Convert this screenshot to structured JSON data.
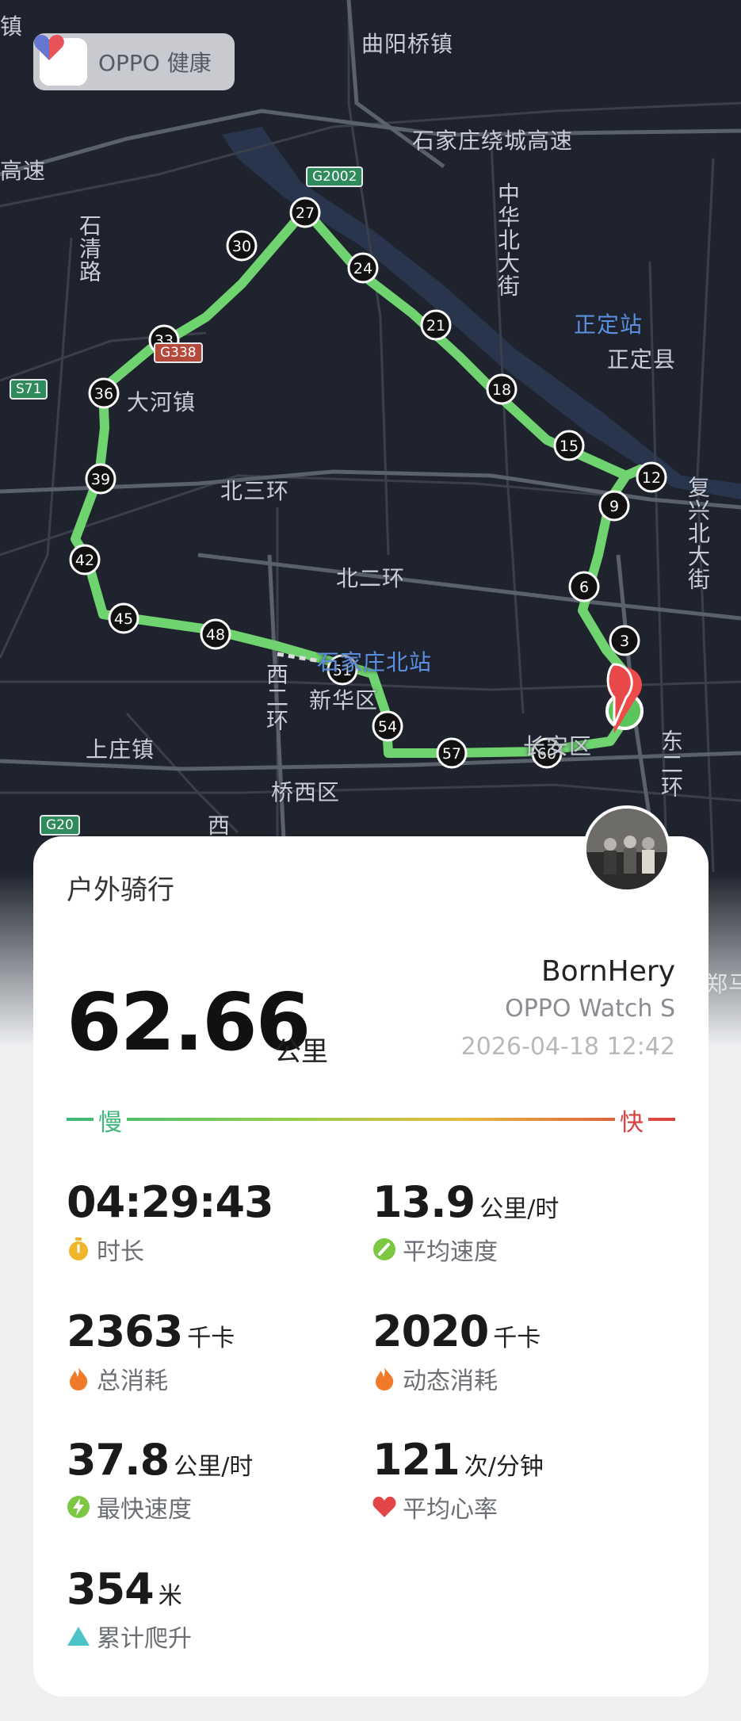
{
  "app": {
    "name": "OPPO 健康"
  },
  "map": {
    "labels": {
      "quyang": "曲阳桥镇",
      "ring_expressway": "石家庄绕城高速",
      "zhonghua_street": "中华北大街",
      "shiqing_road": "石清路",
      "high_speed": "高速",
      "zhengding_station": "正定站",
      "zhengding_county": "正定县",
      "dahe_town": "大河镇",
      "north_third_ring": "北三环",
      "fuxing_street": "复兴北大街",
      "north_second_ring": "北二环",
      "north_station": "石家庄北站",
      "xinhua": "新华区",
      "west_second_ring": "西二环",
      "shangzhuang": "上庄镇",
      "qiaoxi": "桥西区",
      "changan": "长安区",
      "east_second_ring": "东二环",
      "edge_top": "镇",
      "edge_right": "郑马",
      "edge_west": "西"
    },
    "shields": {
      "g2002": "G2002",
      "g338": "G338",
      "s71": "S71",
      "g20": "G20"
    },
    "km_markers": [
      "3",
      "6",
      "9",
      "12",
      "15",
      "18",
      "21",
      "24",
      "27",
      "30",
      "33",
      "36",
      "39",
      "42",
      "45",
      "48",
      "51",
      "54",
      "57",
      "60"
    ]
  },
  "workout": {
    "sport": "户外骑行",
    "distance": "62.66",
    "distance_unit": "公里",
    "user": "BornHery",
    "device": "OPPO Watch S",
    "datetime": "2026-04-18 12:42",
    "slow_label": "慢",
    "fast_label": "快",
    "colors": {
      "slow": "#3cb878",
      "fast": "#d94040",
      "route": "#6fd36f"
    }
  },
  "stats": {
    "duration": {
      "value": "04:29:43",
      "unit": "",
      "label": "时长",
      "icon": "stopwatch-icon"
    },
    "avg_speed": {
      "value": "13.9",
      "unit": "公里/时",
      "label": "平均速度",
      "icon": "speedometer-icon"
    },
    "total_cal": {
      "value": "2363",
      "unit": "千卡",
      "label": "总消耗",
      "icon": "flame-icon"
    },
    "active_cal": {
      "value": "2020",
      "unit": "千卡",
      "label": "动态消耗",
      "icon": "flame-icon"
    },
    "max_speed": {
      "value": "37.8",
      "unit": "公里/时",
      "label": "最快速度",
      "icon": "lightning-icon"
    },
    "avg_hr": {
      "value": "121",
      "unit": "次/分钟",
      "label": "平均心率",
      "icon": "heart-icon"
    },
    "ascent": {
      "value": "354",
      "unit": "米",
      "label": "累计爬升",
      "icon": "triangle-icon"
    }
  }
}
